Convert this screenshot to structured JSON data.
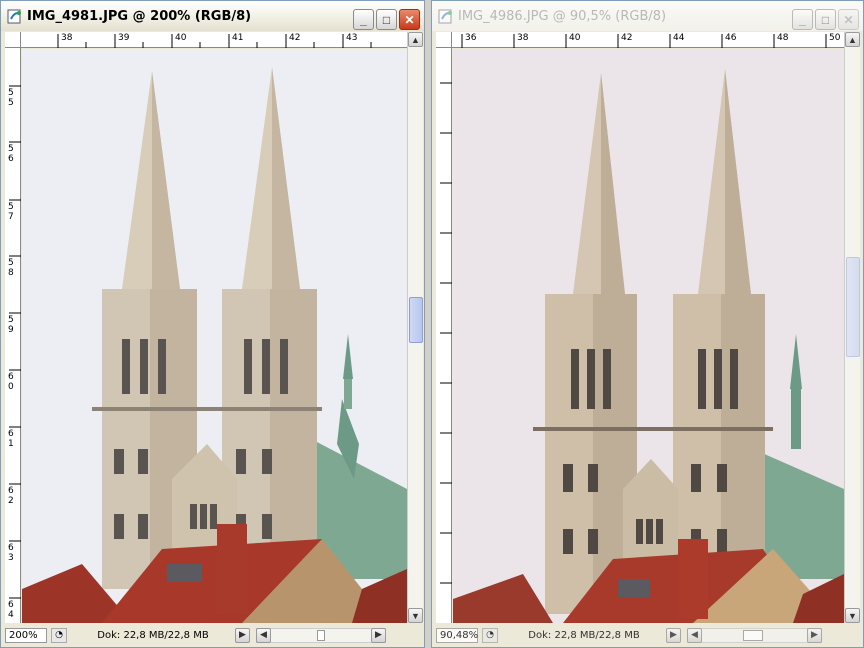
{
  "left_window": {
    "title": "IMG_4981.JPG @ 200% (RGB/8)",
    "ruler_top": [
      "38",
      "39",
      "40",
      "41",
      "42",
      "43"
    ],
    "ruler_left": [
      "5",
      "6",
      "7",
      "8",
      "9",
      "0",
      "1",
      "2",
      "3",
      "4"
    ],
    "ruler_left_prefix": [
      "5",
      "5",
      "5",
      "5",
      "5",
      "6",
      "6",
      "6",
      "6",
      "6"
    ],
    "zoom_value": "200%",
    "doc_info": "Dok: 22,8 MB/22,8 MB"
  },
  "right_window": {
    "title": "IMG_4986.JPG @ 90,5% (RGB/8)",
    "ruler_top": [
      "36",
      "38",
      "40",
      "42",
      "44",
      "46",
      "48",
      "50"
    ],
    "zoom_value": "90,48%",
    "doc_info": "Dok: 22,8 MB/22,8 MB"
  },
  "window_buttons": {
    "minimize": "_",
    "maximize": "□",
    "close": "✕"
  },
  "scroll_arrows": {
    "up": "▲",
    "down": "▼",
    "left": "◀",
    "right": "▶"
  },
  "colors": {
    "sky_left": "#eceef3",
    "sky_right": "#ebe4e8",
    "stone": "#cfc3ae",
    "roof_red": "#a8392a",
    "copper_green": "#7fa892"
  },
  "icons": {
    "app": "photoshop-document-icon",
    "status": "document-status-icon"
  }
}
